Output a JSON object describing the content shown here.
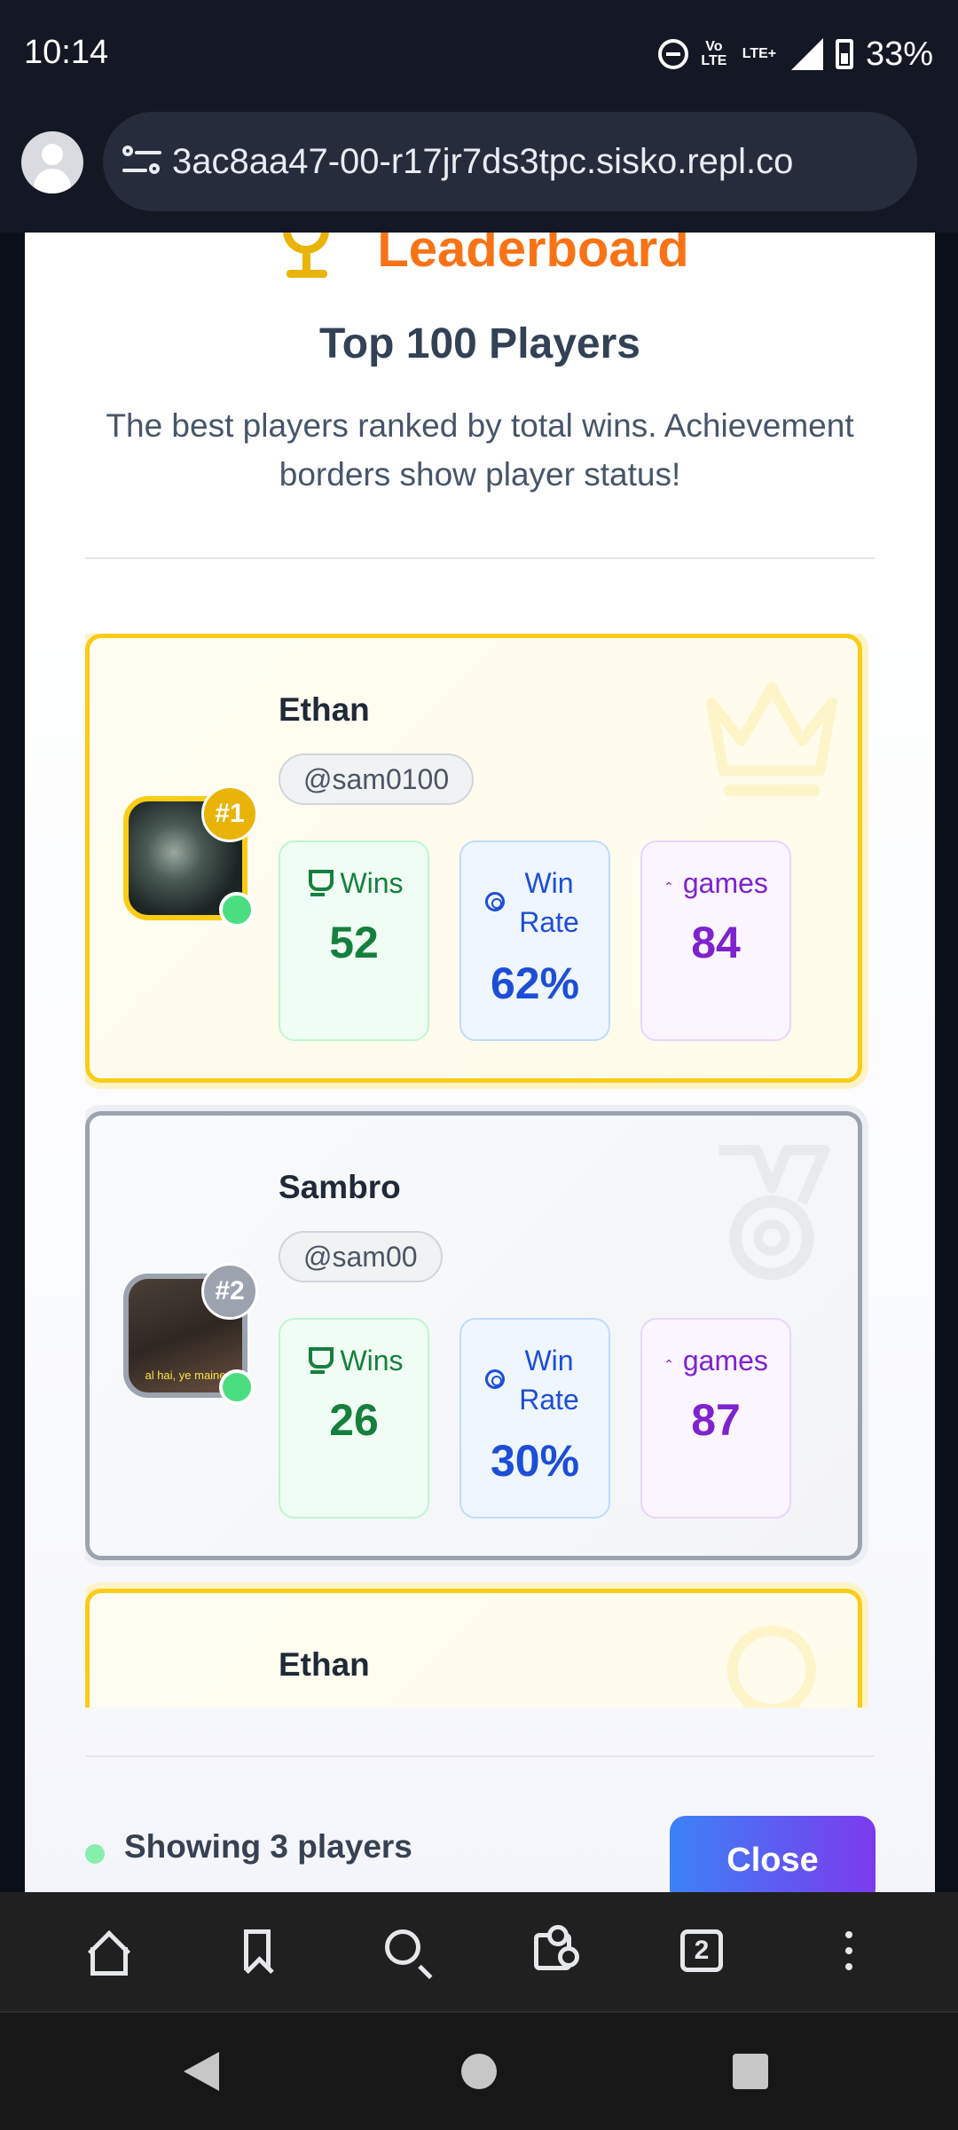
{
  "status_bar": {
    "time": "10:14",
    "volte": "Vo LTE",
    "lte": "LTE+",
    "battery": "33%"
  },
  "browser": {
    "url": "3ac8aa47-00-r17jr7ds3tpc.sisko.repl.co",
    "tab_count": "2"
  },
  "modal": {
    "title": "Leaderboard",
    "subtitle": "Top 100 Players",
    "description": "The best players ranked by total wins. Achievement borders show player status!",
    "footer_text": "Showing 3 players",
    "close_label": "Close"
  },
  "labels": {
    "wins": "Wins",
    "win_rate": "Win Rate",
    "games": "games"
  },
  "players": [
    {
      "rank": "#1",
      "name": "Ethan",
      "handle": "@sam0100",
      "wins": "52",
      "win_rate": "62%",
      "games": "84",
      "tier": "gold"
    },
    {
      "rank": "#2",
      "name": "Sambro",
      "handle": "@sam00",
      "wins": "26",
      "win_rate": "30%",
      "games": "87",
      "tier": "silver",
      "avatar_caption": "al hai, ye maine"
    },
    {
      "name": "Ethan",
      "tier": "gold"
    }
  ],
  "colors": {
    "accent_orange": "#f97316",
    "gold": "#facc15",
    "silver": "#9ca3af",
    "button_start": "#3b82f6",
    "button_end": "#7c3aed"
  }
}
